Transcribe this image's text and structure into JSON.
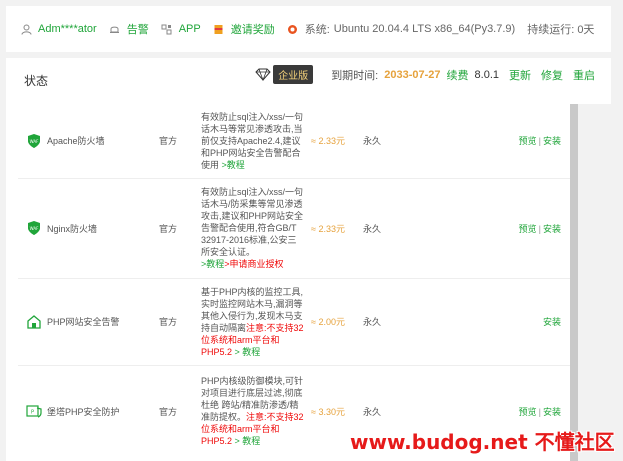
{
  "topbar": {
    "user": "Adm****ator",
    "alerts": "告警",
    "app": "APP",
    "invite": "邀请奖励",
    "system_label": "系统:",
    "system_value": "Ubuntu 20.04.4 LTS x86_64(Py3.7.9)",
    "uptime": "持续运行: 0天"
  },
  "panel": {
    "title": "状态",
    "edition": "企业版",
    "expire_label": "到期时间:",
    "expire_date": "2033-07-27",
    "renew": "续费",
    "version": "8.0.1",
    "update": "更新",
    "repair": "修复",
    "restart": "重启"
  },
  "plugins": [
    {
      "name": "Apache防火墙",
      "source": "官方",
      "desc": "有效防止sql注入/xss/一句话木马等常见渗透攻击,当前仅支持Apache2.4,建议和PHP网站安全告警配合使用 ",
      "desc_link": ">教程",
      "desc_link2": "",
      "desc_warn": "",
      "desc_tail": "",
      "price": "≈ 2.33元",
      "term": "永久",
      "preview": "预览",
      "install": "安装"
    },
    {
      "name": "Nginx防火墙",
      "source": "官方",
      "desc": "有效防止sql注入/xss/一句话木马/防采集等常见渗透攻击,建议和PHP网站安全告警配合使用,符合GB/T 32917-2016标准,公安三所安全认证。",
      "desc_link": ">教程",
      "desc_link2": ">申请商业授权",
      "desc_warn": "",
      "desc_tail": "",
      "price": "≈ 2.33元",
      "term": "永久",
      "preview": "预览",
      "install": "安装"
    },
    {
      "name": "PHP网站安全告警",
      "source": "官方",
      "desc": "基于PHP内核的监控工具,实时监控网站木马,漏洞等其他入侵行为,发现木马支持自动隔离",
      "desc_link": "",
      "desc_link2": "",
      "desc_warn": "注意:不支持32位系统和arm平台和PHP5.2",
      "desc_tail": " > 教程",
      "price": "≈ 2.00元",
      "term": "永久",
      "preview": "",
      "install": "安装"
    },
    {
      "name": "堡塔PHP安全防护",
      "source": "官方",
      "desc": "PHP内核级防御模块,可针对项目进行底层过滤,彻底杜绝 跨站/精准防渗透/精准防提权。",
      "desc_link": "",
      "desc_link2": "",
      "desc_warn": "注意:不支持32位系统和arm平台和PHP5.2",
      "desc_tail": " > 教程",
      "price": "≈ 3.30元",
      "term": "永久",
      "preview": "预览",
      "install": "安装"
    }
  ],
  "watermark": "www.budog.net 不懂社区",
  "colors": {
    "accent": "#20a53a",
    "price": "#e6a23c",
    "warn": "#ef0808"
  }
}
